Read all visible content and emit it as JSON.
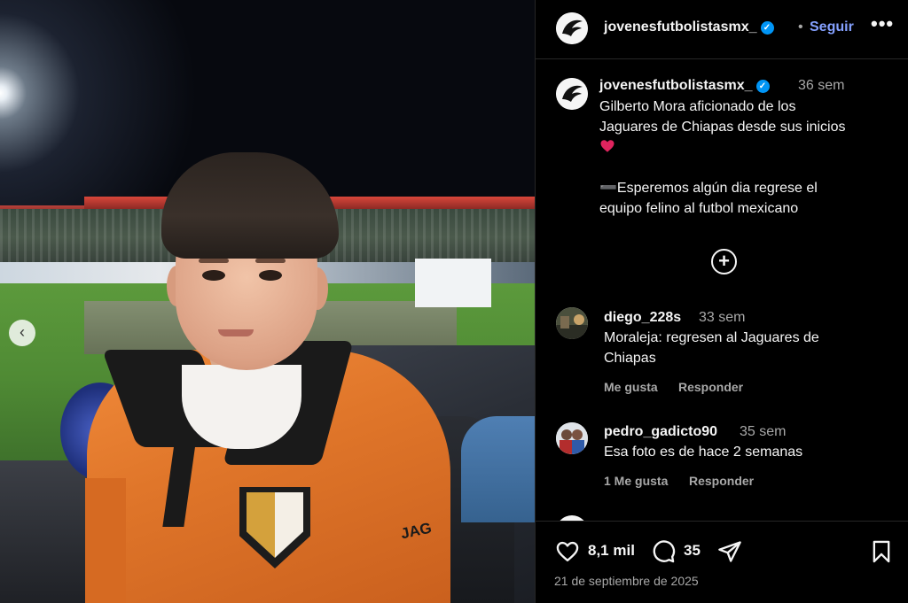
{
  "post": {
    "username": "jovenesfutbolistasmx_",
    "verified_badge": "✓",
    "separator": "•",
    "follow_label": "Seguir",
    "more_label": "•••",
    "jersey_text": "JAG"
  },
  "caption": {
    "username": "jovenesfutbolistasmx_",
    "time": "36 sem",
    "lines": [
      "Gilberto Mora aficionado de los",
      "Jaguares de Chiapas desde sus inicios",
      "➖Esperemos algún dia regrese el",
      "equipo felino al futbol mexicano"
    ],
    "emoji": "red-heart",
    "expand_label": "+"
  },
  "comments": [
    {
      "username": "diego_228s",
      "time": "33 sem",
      "lines": [
        "Moraleja: regresen al Jaguares de",
        "Chiapas"
      ],
      "like_label": "Me gusta",
      "reply_label": "Responder"
    },
    {
      "username": "pedro_gadicto90",
      "time": "35 sem",
      "lines": [
        "Esa foto es de hace 2 semanas"
      ],
      "like_label": "1 Me gusta",
      "reply_label": "Responder"
    }
  ],
  "actions": {
    "likes": "8,1 mil",
    "comments": "35",
    "date": "21 de septiembre de 2025"
  },
  "icons": {
    "carousel_prev": "chevron-left-icon",
    "like": "heart-icon",
    "comment": "comment-icon",
    "share": "send-icon",
    "save": "bookmark-icon"
  },
  "colors": {
    "background": "#000000",
    "text": "#f5f5f5",
    "secondary_text": "#a8a8a8",
    "follow_link": "#85a1ff",
    "verified": "#0095f6",
    "jersey": "#e0762a"
  }
}
